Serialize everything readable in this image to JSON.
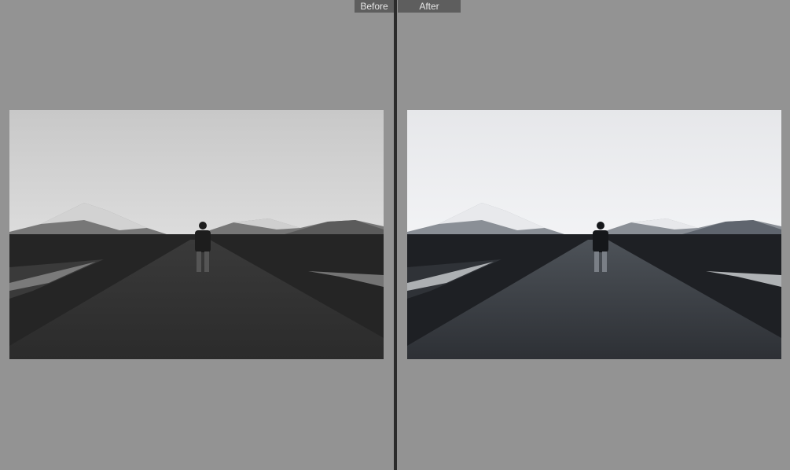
{
  "compare_view": {
    "before_label": "Before",
    "after_label": "After"
  },
  "photos": {
    "before": {
      "icon": "landscape-photo-before"
    },
    "after": {
      "icon": "landscape-photo-after"
    }
  }
}
